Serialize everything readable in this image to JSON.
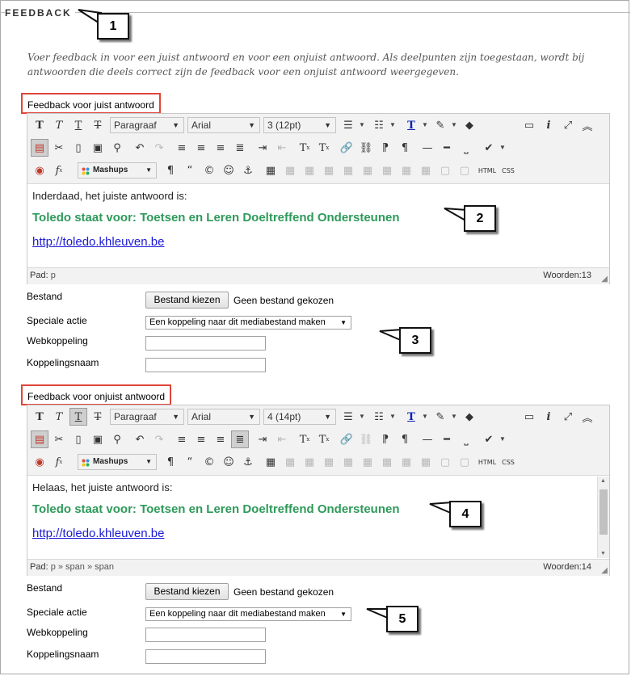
{
  "section_title": "FEEDBACK",
  "intro_text": "Voer feedback in voor een juist antwoord en voor een onjuist antwoord. Als deelpunten zijn toegestaan, wordt bij antwoorden die deels correct zijn de feedback voor een onjuist antwoord weergegeven.",
  "toolbar_labels": {
    "bold": "T",
    "italic": "T",
    "underline": "T",
    "strike": "T",
    "mashups": "Mashups",
    "html": "HTML",
    "css": "CSS",
    "superscript": "T",
    "subscript": "T",
    "fx": "f",
    "pilcrow": "¶",
    "quote": "“",
    "copyright": "©",
    "info": "i"
  },
  "correct": {
    "label": "Feedback voor juist antwoord",
    "paragraph_select": "Paragraaf",
    "font_select": "Arial",
    "size_select": "3 (12pt)",
    "line1": "Inderdaad, het juiste antwoord is:",
    "line2": "Toledo staat voor: Toetsen en Leren Doeltreffend Ondersteunen",
    "line3": "http://toledo.khleuven.be",
    "path_label": "Pad:",
    "path_value": "p",
    "words": "Woorden:13"
  },
  "incorrect": {
    "label": "Feedback voor onjuist antwoord",
    "paragraph_select": "Paragraaf",
    "font_select": "Arial",
    "size_select": "4 (14pt)",
    "line1": "Helaas, het juiste antwoord is:",
    "line2": "Toledo staat voor: Toetsen en Leren Doeltreffend Ondersteunen",
    "line3": "http://toledo.khleuven.be",
    "path_label": "Pad:",
    "path_value": "p » span » span",
    "words": "Woorden:14"
  },
  "form": {
    "file_label": "Bestand",
    "file_button": "Bestand kiezen",
    "file_none": "Geen bestand gekozen",
    "action_label": "Speciale actie",
    "action_value": "Een koppeling naar dit mediabestand maken",
    "weblink_label": "Webkoppeling",
    "linkname_label": "Koppelingsnaam"
  },
  "callouts": [
    "1",
    "2",
    "3",
    "4",
    "5"
  ],
  "colors": {
    "callout_border": "#e0463b",
    "green_text": "#2e9a5a",
    "link": "#1b1bd6"
  }
}
